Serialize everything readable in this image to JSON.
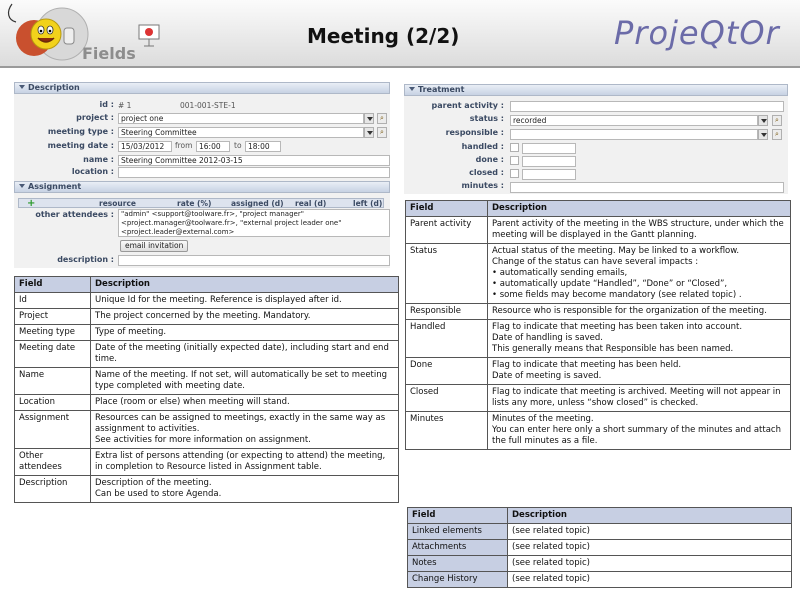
{
  "header": {
    "logo_text": "Fields",
    "title": "Meeting (2/2)",
    "brand": "ProjeQtOr"
  },
  "colors": {
    "header_bg": "#e4e4e4",
    "section_head": "#c7d2e3",
    "table_head": "#c7cfe3",
    "brand": "#6b6ba8"
  },
  "description_section": {
    "heading": "Description",
    "fields": {
      "id_label": "id :",
      "id_value": "# 1",
      "id_ref": "001-001-STE-1",
      "project_label": "project :",
      "project_value": "project one",
      "meeting_type_label": "meeting type :",
      "meeting_type_value": "Steering Committee",
      "meeting_date_label": "meeting date :",
      "meeting_date_value": "15/03/2012",
      "from_label": "from",
      "from_value": "16:00",
      "to_label": "to",
      "to_value": "18:00",
      "name_label": "name :",
      "name_value": "Steering Committee 2012-03-15",
      "location_label": "location :",
      "location_value": ""
    }
  },
  "assignment_section": {
    "heading": "Assignment",
    "add_icon": "+",
    "columns": [
      "resource",
      "rate (%)",
      "assigned (d)",
      "real (d)",
      "left (d)"
    ],
    "other_attendees_label": "other attendees :",
    "other_attendees_lines": [
      "\"admin\" <support@toolware.fr>, \"project manager\"",
      "<project.manager@toolware.fr>, \"external project leader one\"",
      "<project.leader@external.com>"
    ],
    "email_button": "email invitation",
    "description_label": "description :"
  },
  "treatment_section": {
    "heading": "Treatment",
    "parent_activity_label": "parent activity :",
    "status_label": "status :",
    "status_value": "recorded",
    "responsible_label": "responsible :",
    "handled_label": "handled :",
    "done_label": "done :",
    "closed_label": "closed :",
    "minutes_label": "minutes :"
  },
  "left_table": {
    "headers": [
      "Field",
      "Description"
    ],
    "rows": [
      {
        "field": "Id",
        "lines": [
          "Unique Id for the meeting. Reference is displayed after id."
        ]
      },
      {
        "field": "Project",
        "lines": [
          "The project concerned by the meeting. Mandatory."
        ]
      },
      {
        "field": "Meeting type",
        "lines": [
          "Type of meeting."
        ]
      },
      {
        "field": "Meeting date",
        "lines": [
          "Date of the meeting (initially expected date), including start and end time."
        ]
      },
      {
        "field": "Name",
        "lines": [
          "Name of the meeting. If not set, will automatically be set to meeting type completed with meeting date."
        ]
      },
      {
        "field": "Location",
        "lines": [
          "Place (room or else) when meeting will stand."
        ]
      },
      {
        "field": "Assignment",
        "lines": [
          "Resources can be assigned to meetings, exactly in the same way as assignment to activities.",
          "See activities for more information on assignment."
        ]
      },
      {
        "field": "Other attendees",
        "lines": [
          "Extra list of persons attending (or expecting to attend) the meeting, in completion to Resource listed in Assignment table."
        ]
      },
      {
        "field": "Description",
        "lines": [
          "Description of the meeting.",
          "Can be used to store Agenda."
        ]
      }
    ]
  },
  "right_table": {
    "headers": [
      "Field",
      "Description"
    ],
    "parent_activity": {
      "field": "Parent activity",
      "text": "Parent activity of the meeting in the WBS structure, under which the meeting will be displayed in the Gantt planning."
    },
    "status": {
      "field": "Status",
      "line1": "Actual status of the meeting. May be linked to a workflow.",
      "line2": "Change of the status can have several impacts :",
      "bullets": [
        "automatically sending emails,",
        "automatically update “Handled”, “Done” or “Closed”,",
        "some fields may become mandatory (see related topic) ."
      ]
    },
    "responsible": {
      "field": "Responsible",
      "text": "Resource who is responsible for the organization of the meeting."
    },
    "handled": {
      "field": "Handled",
      "lines": [
        "Flag to indicate that meeting has been taken into account.",
        "Date of handling is saved.",
        "This generally means that Responsible has been named."
      ]
    },
    "done": {
      "field": "Done",
      "lines": [
        "Flag to indicate that meeting has been held.",
        "Date of meeting is saved."
      ]
    },
    "closed": {
      "field": "Closed",
      "lines": [
        "Flag to indicate that meeting is archived. Meeting will not appear in lists any more, unless “show closed” is checked."
      ]
    },
    "minutes": {
      "field": "Minutes",
      "lines": [
        "Minutes of the meeting.",
        "You can enter here only a short summary of the minutes and attach the full minutes as a file."
      ]
    }
  },
  "linked_table": {
    "headers": [
      "Field",
      "Description"
    ],
    "rows": [
      {
        "field": "Linked elements",
        "desc": "(see related topic)"
      },
      {
        "field": "Attachments",
        "desc": "(see related topic)"
      },
      {
        "field": "Notes",
        "desc": "(see related topic)"
      },
      {
        "field": "Change History",
        "desc": "(see related topic)"
      }
    ]
  }
}
